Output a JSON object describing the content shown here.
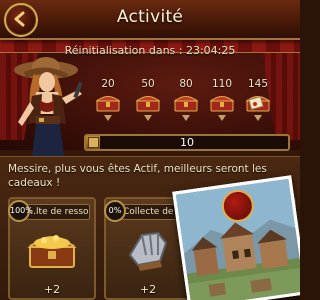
{
  "header": {
    "title": "Activité",
    "back_icon": "back-arrow-icon"
  },
  "reset": {
    "text": "Réinitialisation dans : 23:04:25"
  },
  "milestones": [
    {
      "value": "20",
      "icon": "treasure-chest-icon"
    },
    {
      "value": "50",
      "icon": "treasure-chest-icon"
    },
    {
      "value": "80",
      "icon": "treasure-chest-icon"
    },
    {
      "value": "110",
      "icon": "treasure-chest-icon"
    },
    {
      "value": "145",
      "icon": "treasure-chest-scroll-icon"
    }
  ],
  "progress": {
    "value": "10",
    "fraction": 0.07
  },
  "message": "Messire, plus vous êtes Actif, meilleurs seront les cadeaux !",
  "tasks": [
    {
      "percent": "100%",
      "label": "...lte de resso",
      "reward": "+2",
      "icon": "gold-chest-icon"
    },
    {
      "percent": "0%",
      "label": "Collecte de res",
      "reward": "+2",
      "icon": "gauntlet-icon"
    }
  ],
  "colors": {
    "accent_gold": "#d6a94f",
    "header_red": "#6a2a10"
  }
}
